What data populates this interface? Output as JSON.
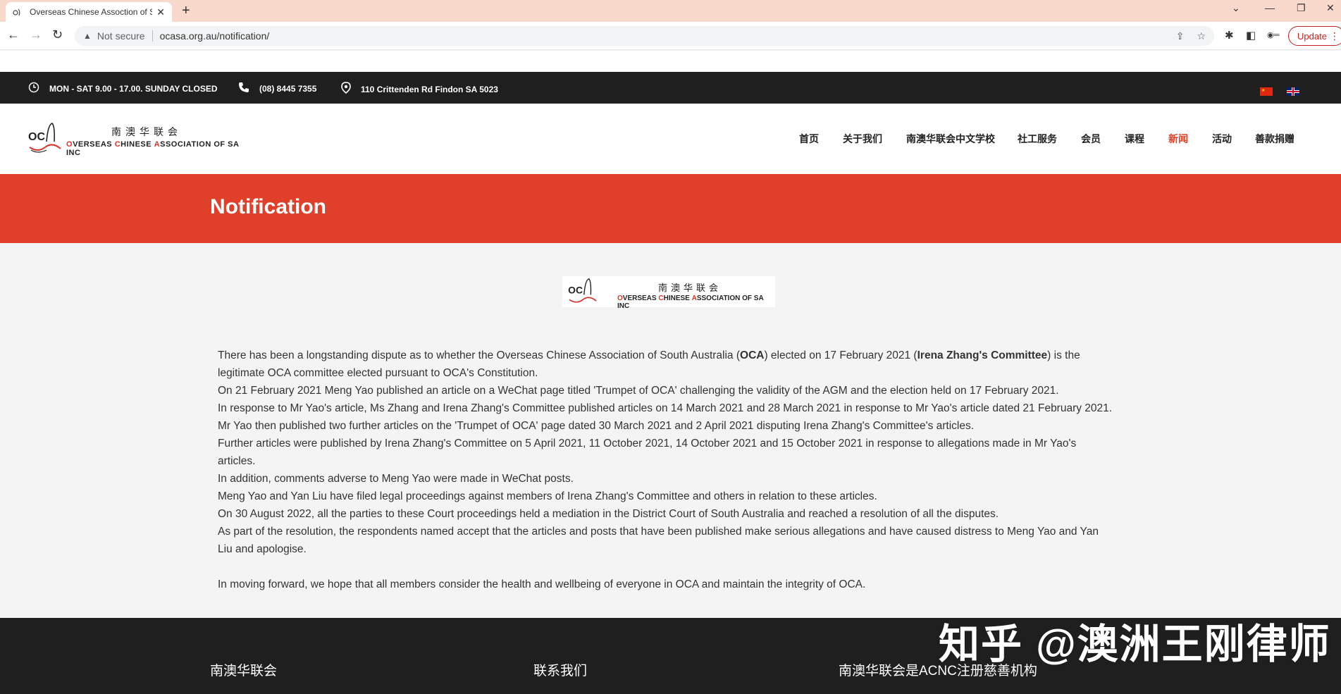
{
  "browser": {
    "tab_title": "Overseas Chinese Assoction of Sa",
    "new_tab": "+",
    "not_secure": "Not secure",
    "url": "ocasa.org.au/notification/",
    "update_label": "Update"
  },
  "infobar": {
    "hours": "MON - SAT 9.00 - 17.00. SUNDAY CLOSED",
    "phone": "(08) 8445 7355",
    "address": "110 Crittenden Rd Findon SA 5023"
  },
  "logo": {
    "zh": "南澳华联会",
    "en_prefix_o": "O",
    "en_rest1": "VERSEAS ",
    "en_c": "C",
    "en_rest2": "HINESE ",
    "en_a": "A",
    "en_rest3": "SSOCIATION OF SA INC"
  },
  "nav": {
    "items": [
      "首页",
      "关于我们",
      "南澳华联会中文学校",
      "社工服务",
      "会员",
      "课程",
      "新闻",
      "活动",
      "善款捐赠"
    ],
    "active_index": 6
  },
  "banner": {
    "title": "Notification"
  },
  "article": {
    "p1_a": "There has been a longstanding dispute as to whether the Overseas Chinese Association of South Australia (",
    "p1_b": "OCA",
    "p1_c": ") elected on 17 February 2021 (",
    "p1_d": "Irena Zhang's Committee",
    "p1_e": ") is the legitimate OCA committee elected pursuant to OCA's Constitution.",
    "p2": "On 21 February 2021 Meng Yao published an article on a WeChat page titled 'Trumpet of OCA' challenging the validity of the AGM and the election held on 17 February 2021.",
    "p3": "In response to Mr Yao's article, Ms Zhang and Irena Zhang's Committee published articles on 14 March 2021 and 28 March 2021 in response to Mr Yao's article dated 21 February 2021.",
    "p4": "Mr Yao then published two further articles on the 'Trumpet of OCA' page dated 30 March 2021 and 2 April 2021 disputing Irena Zhang's Committee's articles.",
    "p5": "Further articles were published by Irena Zhang's Committee on 5 April 2021, 11 October 2021, 14 October 2021 and 15 October 2021 in response to allegations made in Mr Yao's articles.",
    "p6": "In addition, comments adverse to Meng Yao were made in WeChat posts.",
    "p7": "Meng Yao and Yan Liu have filed legal proceedings against members of Irena Zhang's Committee and others in relation to these articles.",
    "p8": "On 30 August 2022, all the parties to these Court proceedings held a mediation in the District Court of South Australia and reached a resolution of all the disputes.",
    "p9": "As part of the resolution, the respondents named accept that the articles and posts that have been published make serious allegations and have caused distress to Meng Yao and Yan Liu and apologise.",
    "p10": "In moving forward, we hope that all members consider the health and wellbeing of everyone in OCA and maintain the integrity of OCA."
  },
  "footer": {
    "col1": "南澳华联会",
    "col2": "联系我们",
    "col3": "南澳华联会是ACNC注册慈善机构"
  },
  "watermark": "知乎 @澳洲王刚律师",
  "colors": {
    "accent": "#e0402a",
    "dark": "#1f1f1f",
    "tab_strip": "#f8d9cc"
  }
}
